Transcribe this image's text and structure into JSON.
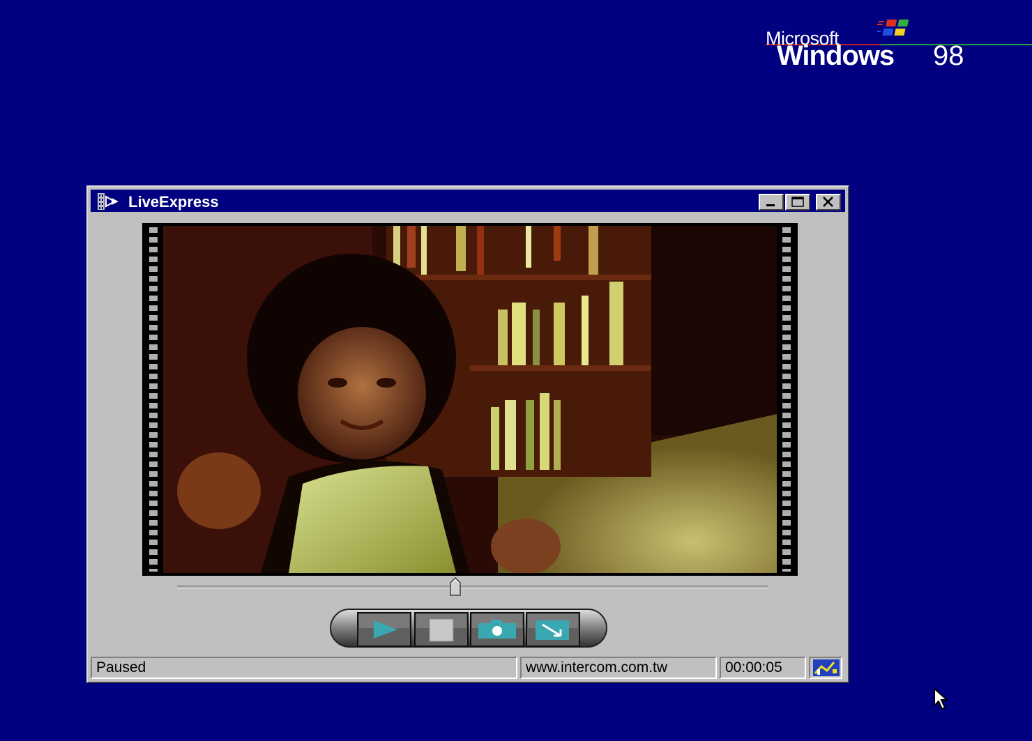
{
  "desktop": {
    "logo_brand": "Microsoft",
    "logo_product": "Windows",
    "logo_version": "98"
  },
  "window": {
    "title": "LiveExpress",
    "icon": "film-strip-icon",
    "buttons": [
      "minimize",
      "maximize",
      "close"
    ]
  },
  "video": {
    "description_icon": "video-preview"
  },
  "seek": {
    "position_fraction": 0.47
  },
  "controls": {
    "buttons": [
      "play",
      "stop",
      "snapshot",
      "save"
    ]
  },
  "statusbar": {
    "state": "Paused",
    "url": "www.intercom.com.tw",
    "time": "00:00:05",
    "icon": "connection-graph-icon"
  },
  "colors": {
    "desktop": "#000080",
    "titlebar": "#000080",
    "face": "#c0c0c0",
    "control_accent": "#3aa8b0"
  }
}
